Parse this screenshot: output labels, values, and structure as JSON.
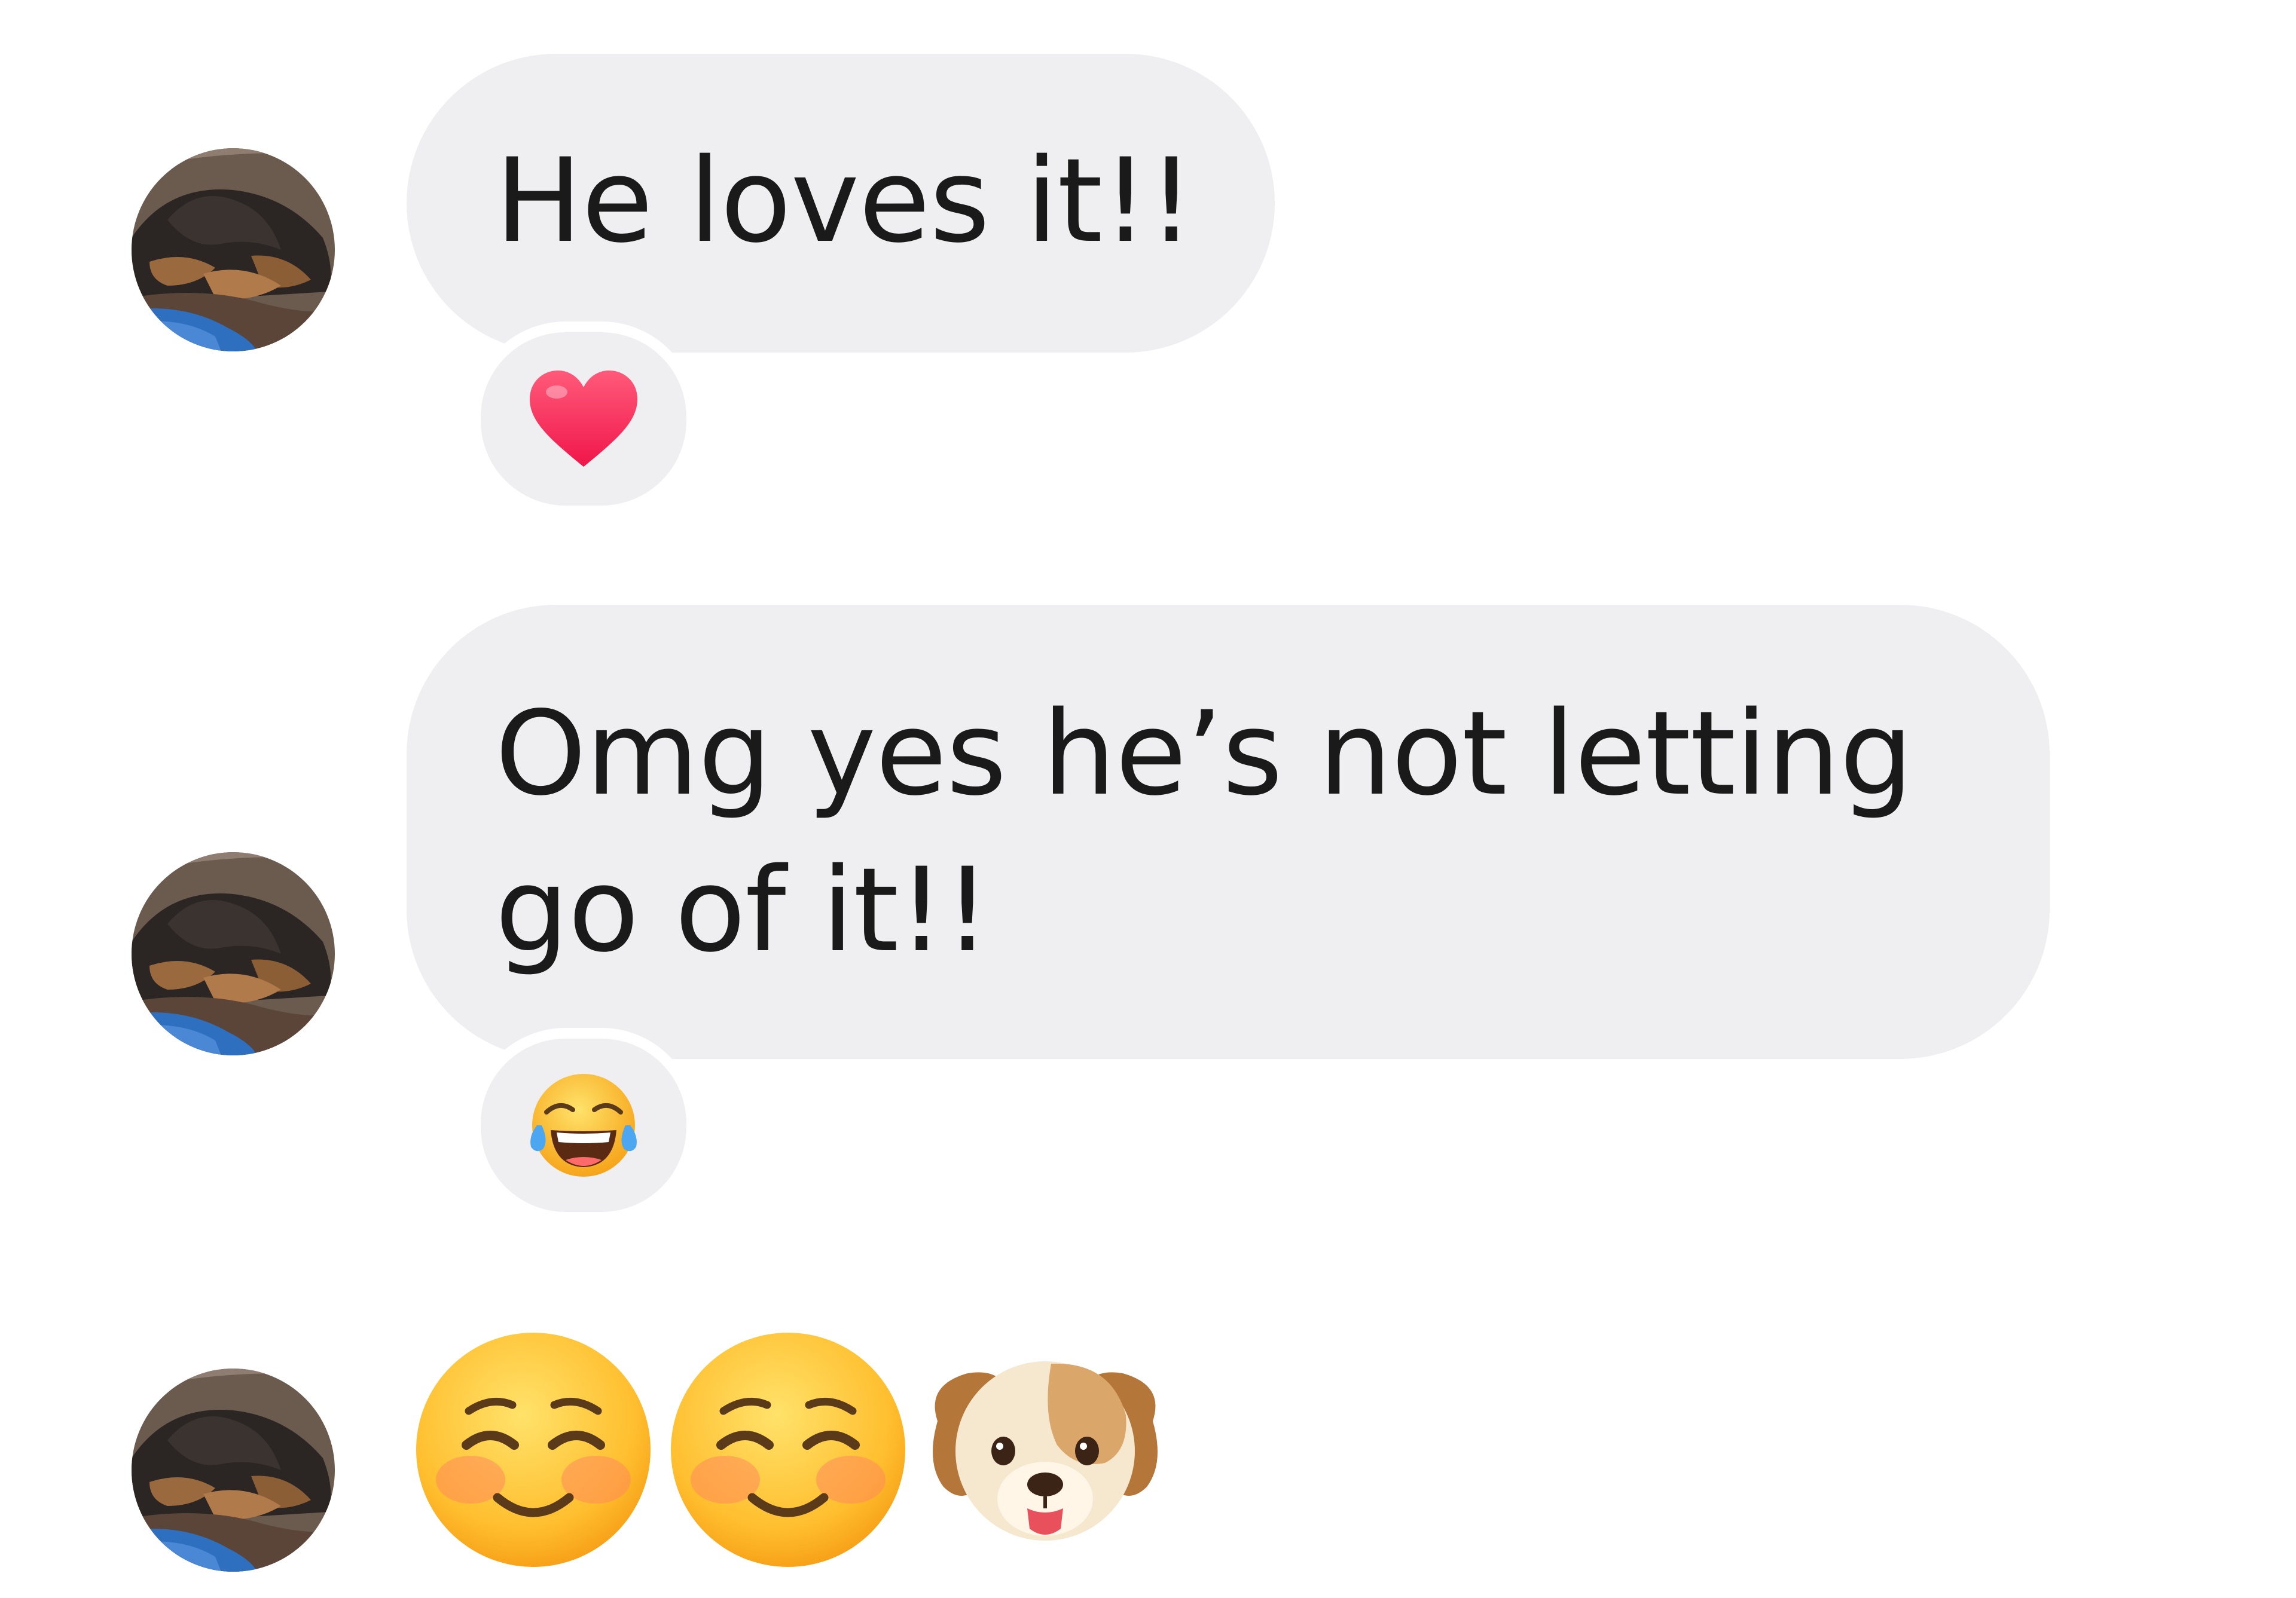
{
  "messages": [
    {
      "text_lines": [
        "He loves it!!"
      ],
      "reaction": "heart-emoji",
      "avatar": "dog-photo-avatar"
    },
    {
      "text_lines": [
        "Omg yes he’s not letting",
        "go of it!!"
      ],
      "reaction": "tears-of-joy-emoji",
      "avatar": "dog-photo-avatar"
    },
    {
      "emojis": [
        "smiling-face-emoji",
        "smiling-face-emoji",
        "dog-face-emoji"
      ],
      "avatar": "dog-photo-avatar"
    }
  ],
  "colors": {
    "bubble_background": "#efeef0",
    "text": "#1a1a1a",
    "page_background": "#ffffff",
    "heart": "#ff2d55"
  }
}
